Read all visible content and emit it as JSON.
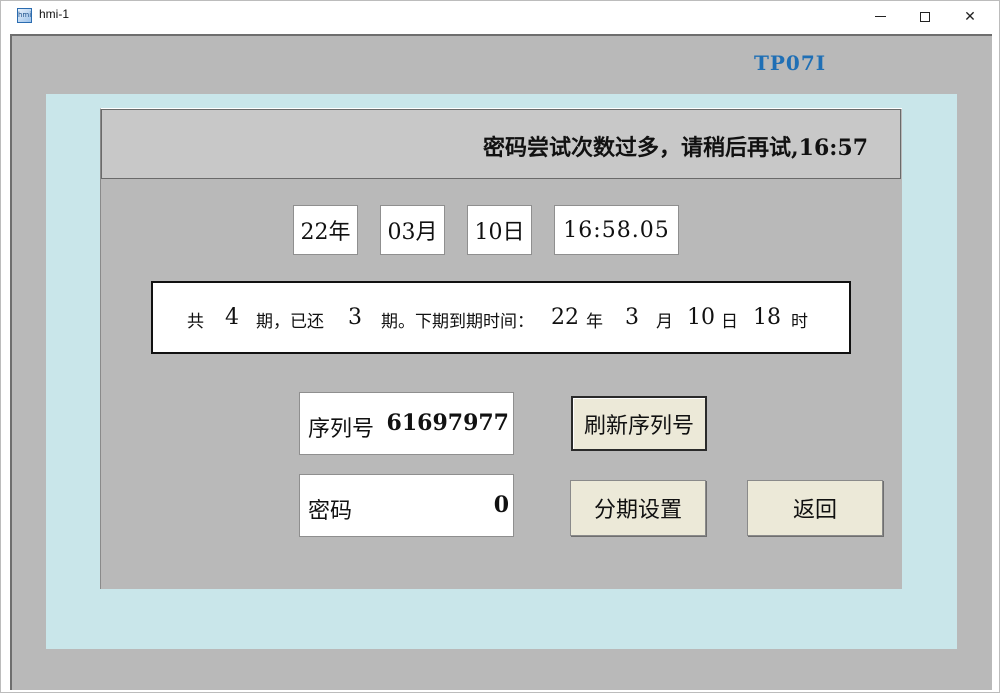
{
  "window": {
    "title": "hmi-1",
    "icon": "app-icon",
    "minimize_icon": "minimize-icon",
    "maximize_icon": "maximize-icon",
    "close_icon": "close-icon",
    "close_glyph": "✕"
  },
  "panel": {
    "brand": "TP07I",
    "banner": "密码尝试次数过多，请稍后再试,16:57"
  },
  "datetime": {
    "year": "22年",
    "month": "03月",
    "day": "10日",
    "time": "16:58.05"
  },
  "installment": {
    "t_total_prefix": "共",
    "total": "4",
    "t_paid_prefix": "期，已还",
    "paid": "3",
    "t_next": "期。下期到期时间：",
    "year": "22",
    "t_year": "年",
    "month": "3",
    "t_month": "月",
    "day": "10",
    "t_day": "日",
    "hour": "18",
    "t_hour": "时"
  },
  "serial": {
    "label": "序列号",
    "value": "61697977"
  },
  "password": {
    "label": "密码",
    "value": "0"
  },
  "buttons": {
    "refresh_serial": "刷新序列号",
    "installment_settings": "分期设置",
    "back": "返回"
  },
  "colors": {
    "client_bg": "#b9b9b9",
    "outer_panel": "#c9e6ea",
    "brand_text": "#1f6fb5",
    "button_bg": "#ece9d8"
  }
}
